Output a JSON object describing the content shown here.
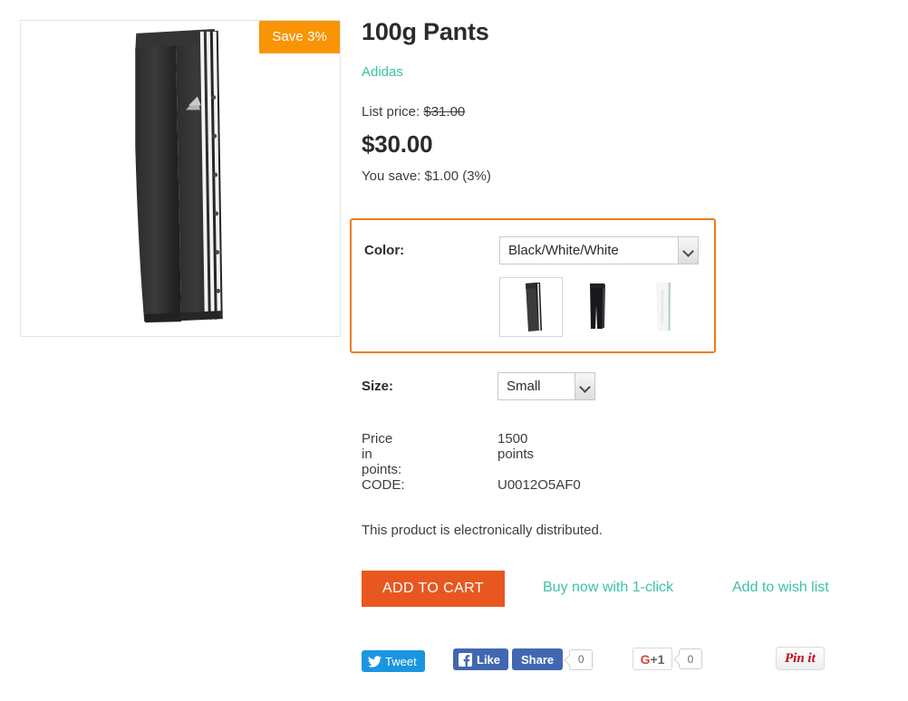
{
  "product": {
    "title": "100g Pants",
    "brand": "Adidas",
    "list_price_label": "List price:",
    "list_price_value": "$31.00",
    "price": "$30.00",
    "you_save": "You save: $1.00 (3%)",
    "save_badge": "Save 3%",
    "electronic_note": "This product is electronically distributed."
  },
  "options": {
    "color": {
      "label": "Color:",
      "selected": "Black/White/White",
      "swatches": [
        {
          "name": "swatch-black-white-white",
          "selected": true
        },
        {
          "name": "swatch-black",
          "selected": false
        },
        {
          "name": "swatch-white",
          "selected": false
        }
      ]
    },
    "size": {
      "label": "Size:",
      "selected": "Small"
    }
  },
  "info_rows": [
    {
      "key": "Price in points:",
      "value": "1500 points"
    },
    {
      "key": "CODE:",
      "value": "U0012O5AF0"
    }
  ],
  "actions": {
    "add_to_cart": "ADD TO CART",
    "buy_one_click": "Buy now with 1-click",
    "wish_list": "Add to wish list"
  },
  "social": {
    "tweet": "Tweet",
    "fb_like": "Like",
    "fb_share": "Share",
    "fb_count": "0",
    "gplus": "G+1",
    "gplus_count": "0",
    "pinterest": "Pin it"
  },
  "colors": {
    "accent_orange": "#f07d17",
    "cart_orange": "#e8571f",
    "badge_orange": "#f99406",
    "link_teal": "#3cc2a4",
    "twitter_blue": "#1b95e0",
    "facebook_blue": "#4267b2",
    "google_red": "#db4437",
    "pinterest_red": "#bd081c"
  }
}
